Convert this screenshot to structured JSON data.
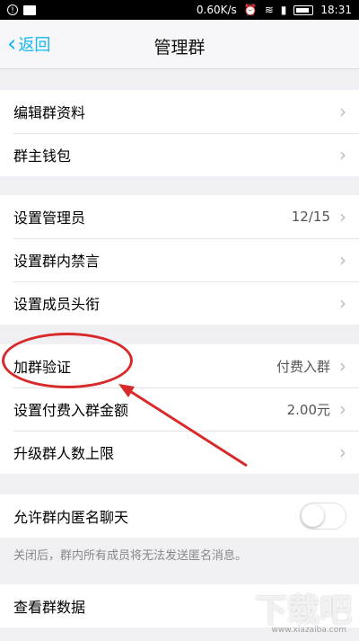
{
  "status_bar": {
    "speed": "0.60K/s",
    "time": "18:31"
  },
  "nav": {
    "back_label": "返回",
    "title": "管理群"
  },
  "groups": {
    "g1": [
      {
        "label": "编辑群资料"
      },
      {
        "label": "群主钱包"
      }
    ],
    "g2": [
      {
        "label": "设置管理员",
        "value": "12/15"
      },
      {
        "label": "设置群内禁言"
      },
      {
        "label": "设置成员头衔"
      }
    ],
    "g3": [
      {
        "label": "加群验证",
        "value": "付费入群"
      },
      {
        "label": "设置付费入群金额",
        "value": "2.00元"
      },
      {
        "label": "升级群人数上限"
      }
    ],
    "g4": [
      {
        "label": "允许群内匿名聊天",
        "toggle_on": false
      }
    ],
    "g4_note": "关闭后，群内所有成员将无法发送匿名消息。",
    "g5": [
      {
        "label": "查看群数据"
      }
    ]
  },
  "icons": {
    "chevron": "chevron-right-icon",
    "back": "chevron-left-icon"
  },
  "colors": {
    "accent": "#12b7f5",
    "annotation": "#d82a2a",
    "background": "#efeff4"
  },
  "watermark": {
    "text": "下载吧",
    "sub": "www.xiazaiba.com"
  }
}
